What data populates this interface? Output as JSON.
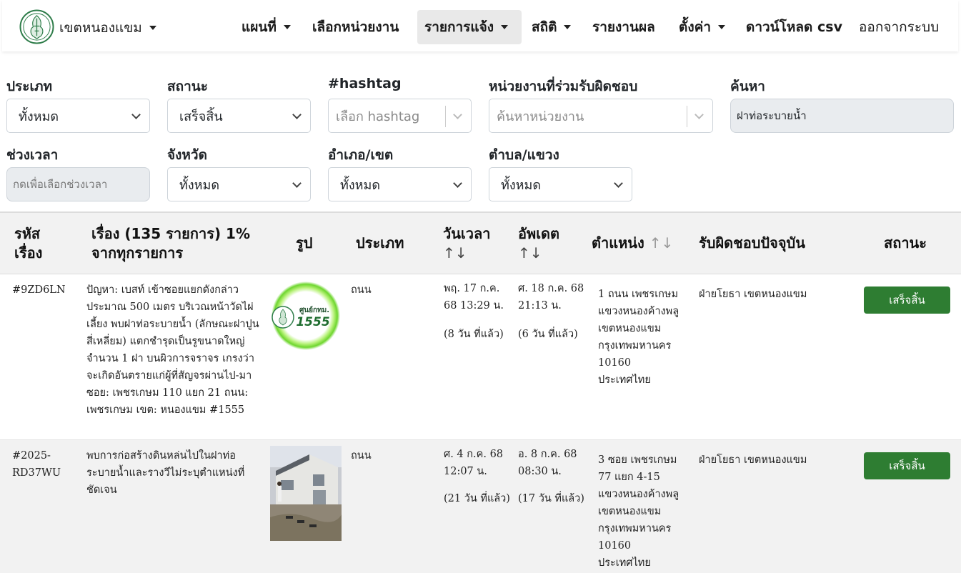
{
  "navbar": {
    "district": "เขตหนองแขม",
    "items": [
      {
        "label": "แผนที่",
        "dropdown": true
      },
      {
        "label": "เลือกหน่วยงาน",
        "dropdown": false
      },
      {
        "label": "รายการแจ้ง",
        "dropdown": true,
        "active": true
      },
      {
        "label": "สถิติ",
        "dropdown": true
      },
      {
        "label": "รายงานผล",
        "dropdown": false
      },
      {
        "label": "ตั้งค่า",
        "dropdown": true
      },
      {
        "label": "ดาวน์โหลด csv",
        "dropdown": false
      },
      {
        "label": "ออกจากระบบ",
        "dropdown": false
      }
    ]
  },
  "filters": {
    "type": {
      "label": "ประเภท",
      "value": "ทั้งหมด"
    },
    "status": {
      "label": "สถานะ",
      "value": "เสร็จสิ้น"
    },
    "hashtag": {
      "label": "#hashtag",
      "placeholder": "เลือก hashtag"
    },
    "agency": {
      "label": "หน่วยงานที่ร่วมรับผิดชอบ",
      "placeholder": "ค้นหาหน่วยงาน"
    },
    "search": {
      "label": "ค้นหา",
      "value": "ฝาท่อระบายน้ำ"
    },
    "period": {
      "label": "ช่วงเวลา",
      "placeholder": "กดเพื่อเลือกช่วงเวลา"
    },
    "province": {
      "label": "จังหวัด",
      "value": "ทั้งหมด"
    },
    "district": {
      "label": "อำเภอ/เขต",
      "value": "ทั้งหมด"
    },
    "subdistrict": {
      "label": "ตำบล/แขวง",
      "value": "ทั้งหมด"
    }
  },
  "table": {
    "headers": {
      "id": "รหัสเรื่อง",
      "subject": "เรื่อง (135 รายการ) 1% จากทุกรายการ",
      "image": "รูป",
      "type": "ประเภท",
      "datetime": "วันเวลา",
      "updated": "อัพเดต",
      "location": "ตำแหน่ง",
      "responsible": "รับผิดชอบปัจจุบัน",
      "status": "สถานะ",
      "sort_glyph": "↑↓"
    },
    "rows": [
      {
        "id": "#9ZD6LN",
        "subject": "ปัญหา: เบสท์ เข้าซอยแยกดังกล่าวประมาณ 500 เมตร บริเวณหน้าวัดไผ่เลี้ยง พบฝาท่อระบายน้ำ (ลักษณะฝาปูนสี่เหลี่ยม) แตกชำรุดเป็นรูขนาดใหญ่ จำนวน 1 ฝา บนผิวการจราจร เกรงว่าจะเกิดอันตรายแก่ผู้ที่สัญจรผ่านไป-มา ซอย: เพชรเกษม 110 แยก 21 ถนน: เพชรเกษม เขต: หนองแขม #1555",
        "image_text": "ศูนย์กทม.",
        "image_number": "1555",
        "type": "ถนน",
        "datetime": "พฤ. 17 ก.ค. 68 13:29 น.",
        "datetime_ago": "(8 วัน ที่แล้ว)",
        "updated": "ศ. 18 ก.ค. 68 21:13 น.",
        "updated_ago": "(6 วัน ที่แล้ว)",
        "location": "1 ถนน เพชรเกษม แขวงหนองค้างพลู เขตหนองแขม กรุงเทพมหานคร 10160 ประเทศไทย",
        "responsible": "ฝ่ายโยธา เขตหนองแขม",
        "status": "เสร็จสิ้น"
      },
      {
        "id": "#2025-RD37WU",
        "subject": "พบการก่อสร้างดินหล่นไปในฝาท่อระบายน้ำและรางวีไม่ระบุตำแหน่งที่ชัดเจน",
        "type": "ถนน",
        "datetime": "ศ. 4 ก.ค. 68 12:07 น.",
        "datetime_ago": "(21 วัน ที่แล้ว)",
        "updated": "อ. 8 ก.ค. 68 08:30 น.",
        "updated_ago": "(17 วัน ที่แล้ว)",
        "location": "3 ซอย เพชรเกษม 77 แยก 4-15 แขวงหนองค้างพลู เขตหนองแขม กรุงเทพมหานคร 10160 ประเทศไทย",
        "responsible": "ฝ่ายโยธา เขตหนองแขม",
        "status": "เสร็จสิ้น"
      }
    ]
  },
  "colors": {
    "accent": "#2e7d32",
    "active_bg": "#e9e9e9",
    "header_bg": "#f2f2f2"
  }
}
